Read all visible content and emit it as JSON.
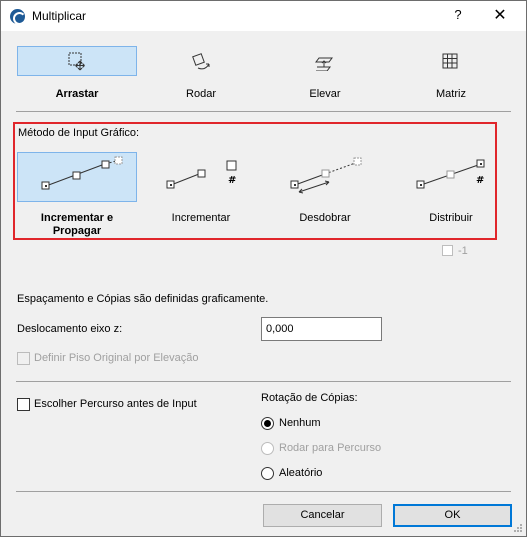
{
  "window": {
    "title": "Multiplicar",
    "help": "?",
    "close": "✕"
  },
  "modes": [
    {
      "label": "Arrastar",
      "icon": "drag-icon"
    },
    {
      "label": "Rodar",
      "icon": "rotate-icon"
    },
    {
      "label": "Elevar",
      "icon": "elevate-icon"
    },
    {
      "label": "Matriz",
      "icon": "matrix-icon"
    }
  ],
  "input_method": {
    "title": "Método de Input Gráfico:",
    "options": [
      {
        "label": "Incrementar e Propagar",
        "icon": "increment-propagate-icon"
      },
      {
        "label": "Incrementar",
        "icon": "increment-icon"
      },
      {
        "label": "Desdobrar",
        "icon": "spread-icon"
      },
      {
        "label": "Distribuir",
        "icon": "distribute-icon"
      }
    ],
    "minus_one": "-1"
  },
  "spacing_text": "Espaçamento e Cópias são definidas graficamente.",
  "z_offset": {
    "label": "Deslocamento eixo z:",
    "value": "0,000"
  },
  "define_floor": "Definir Piso Original por Elevação",
  "choose_path": "Escolher Percurso antes de Input",
  "rotation": {
    "title": "Rotação de Cópias:",
    "options": [
      "Nenhum",
      "Rodar para Percurso",
      "Aleatório"
    ]
  },
  "buttons": {
    "cancel": "Cancelar",
    "ok": "OK"
  }
}
